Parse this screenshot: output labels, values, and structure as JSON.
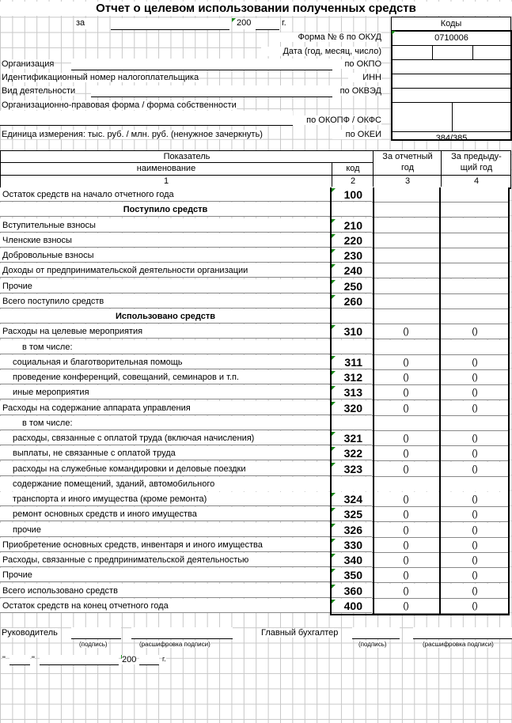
{
  "title": "Отчет о целевом использовании полученных средств",
  "period": {
    "prefix": "за",
    "year": "200",
    "suffix": "г."
  },
  "codes": {
    "header": "Коды",
    "okud_label": "Форма № 6 по ОКУД",
    "okud": "0710006",
    "date_label": "Дата (год, месяц, число)",
    "okpo": "по ОКПО",
    "inn": "ИНН",
    "okved": "по ОКВЭД",
    "okopf": "по ОКОПФ / ОКФС",
    "okei": "по ОКЕИ",
    "okei_value": "384/385"
  },
  "fields": {
    "org": "Организация",
    "inn": "Идентификационный номер налогоплательщика",
    "activity": "Вид деятельности",
    "opf": "Организационно-правовая форма / форма собственности",
    "units": "Единица измерения: тыс. руб. / млн. руб. (ненужное зачеркнуть)"
  },
  "table_header": {
    "indicator": "Показатель",
    "name": "наименование",
    "code": "код",
    "col3a": "За отчетный",
    "col3b": "год",
    "col4a": "За предыду-",
    "col4b": "щий год",
    "n1": "1",
    "n2": "2",
    "n3": "3",
    "n4": "4"
  },
  "rows": [
    {
      "name": "Остаток средств на начало отчетного года",
      "code": "100"
    },
    {
      "name": "Поступило средств",
      "section": true
    },
    {
      "name": "Вступительные взносы",
      "code": "210"
    },
    {
      "name": "Членские взносы",
      "code": "220"
    },
    {
      "name": "Добровольные взносы",
      "code": "230"
    },
    {
      "name": "Доходы от предпринимательской деятельности организации",
      "code": "240"
    },
    {
      "name": "Прочие",
      "code": "250"
    },
    {
      "name": "Всего поступило средств",
      "code": "260"
    },
    {
      "name": "Использовано средств",
      "section": true
    },
    {
      "name": "Расходы на целевые мероприятия",
      "code": "310",
      "v3": "()",
      "v4": "()"
    },
    {
      "name": "в том числе:",
      "indent": 2
    },
    {
      "name": "социальная и благотворительная помощь",
      "code": "311",
      "v3": "()",
      "v4": "()",
      "indent": 1
    },
    {
      "name": "проведение конференций, совещаний, семинаров и т.п.",
      "code": "312",
      "v3": "()",
      "v4": "()",
      "indent": 1
    },
    {
      "name": "иные мероприятия",
      "code": "313",
      "v3": "()",
      "v4": "()",
      "indent": 1
    },
    {
      "name": "Расходы на содержание аппарата управления",
      "code": "320",
      "v3": "()",
      "v4": "()"
    },
    {
      "name": "в том числе:",
      "indent": 2
    },
    {
      "name": "расходы, связанные с оплатой труда (включая начисления)",
      "code": "321",
      "v3": "()",
      "v4": "()",
      "indent": 1
    },
    {
      "name": "выплаты, не связанные с оплатой труда",
      "code": "322",
      "v3": "()",
      "v4": "()",
      "indent": 1
    },
    {
      "name": "расходы на служебные командировки и деловые поездки",
      "code": "323",
      "v3": "()",
      "v4": "()",
      "indent": 1
    },
    {
      "name": "содержание помещений, зданий, автомобильного",
      "indent": 1,
      "cont": true
    },
    {
      "name": "транспорта и иного имущества (кроме ремонта)",
      "code": "324",
      "v3": "()",
      "v4": "()",
      "indent": 1
    },
    {
      "name": "ремонт основных средств и иного имущества",
      "code": "325",
      "v3": "()",
      "v4": "()",
      "indent": 1
    },
    {
      "name": "прочие",
      "code": "326",
      "v3": "()",
      "v4": "()",
      "indent": 1
    },
    {
      "name": "Приобретение основных средств, инвентаря и иного имущества",
      "code": "330",
      "v3": "()",
      "v4": "()"
    },
    {
      "name": "Расходы, связанные с предпринимательской деятельностью",
      "code": "340",
      "v3": "()",
      "v4": "()"
    },
    {
      "name": "Прочие",
      "code": "350",
      "v3": "()",
      "v4": "()"
    },
    {
      "name": "Всего использовано средств",
      "code": "360",
      "v3": "()",
      "v4": "()"
    },
    {
      "name": "Остаток средств на конец отчетного года",
      "code": "400",
      "v3": "()",
      "v4": "()"
    }
  ],
  "footer": {
    "head": "Руководитель",
    "chief_acc": "Главный бухгалтер",
    "sign": "(подпись)",
    "decode": "(расшифровка подписи)",
    "q1": "\"",
    "q2": "\"",
    "year": "200",
    "g": "г."
  }
}
